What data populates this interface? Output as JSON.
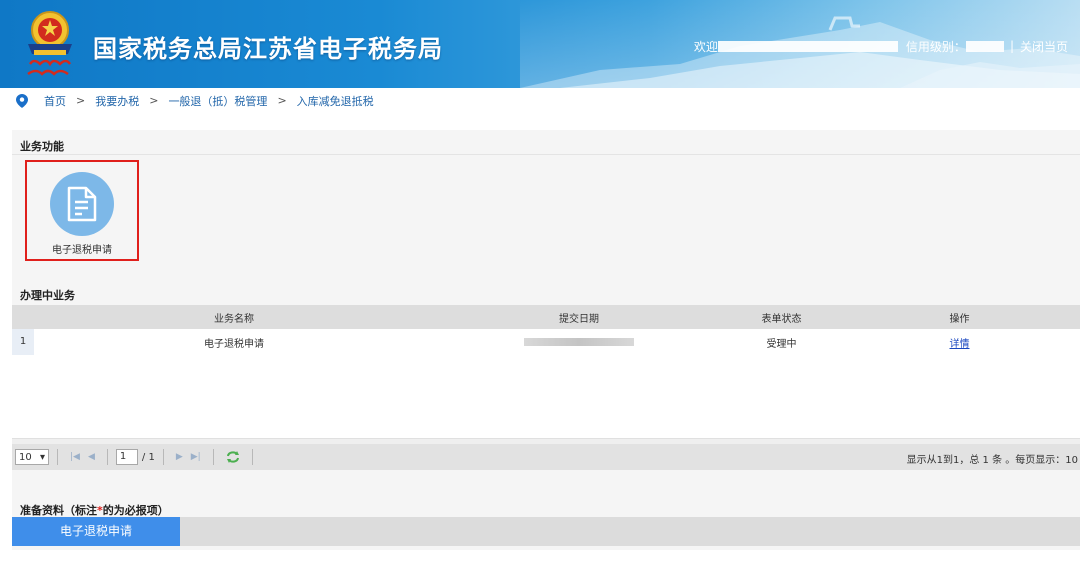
{
  "header": {
    "site_title": "国家税务总局江苏省电子税务局",
    "welcome": "欢迎",
    "credit_label": "信用级别：",
    "separator": "|",
    "close_page": "关闭当页"
  },
  "breadcrumb": {
    "items": [
      "首页",
      "我要办税",
      "一般退（抵）税管理",
      "入库减免退抵税"
    ],
    "arrow": ">"
  },
  "functions": {
    "title": "业务功能",
    "card_label": "电子退税申请"
  },
  "in_progress": {
    "title": "办理中业务",
    "columns": [
      "业务名称",
      "提交日期",
      "表单状态",
      "操作"
    ],
    "rows": [
      {
        "index": "1",
        "name": "电子退税申请",
        "date": "",
        "status": "受理中",
        "action": "详情"
      }
    ]
  },
  "pager": {
    "page_size": "10",
    "current_page": "1",
    "total_pages": "/ 1",
    "info": "显示从1到1，总 1 条 。每页显示：10"
  },
  "materials": {
    "title_prefix": "准备资料（标注",
    "required_mark": "*",
    "title_suffix": "的为必报项）",
    "active_tab": "电子退税申请"
  },
  "colors": {
    "header_blue": "#0f78c6",
    "highlight_red": "#e0201c",
    "tab_blue": "#3f8eea",
    "link_blue": "#1a47c0"
  }
}
